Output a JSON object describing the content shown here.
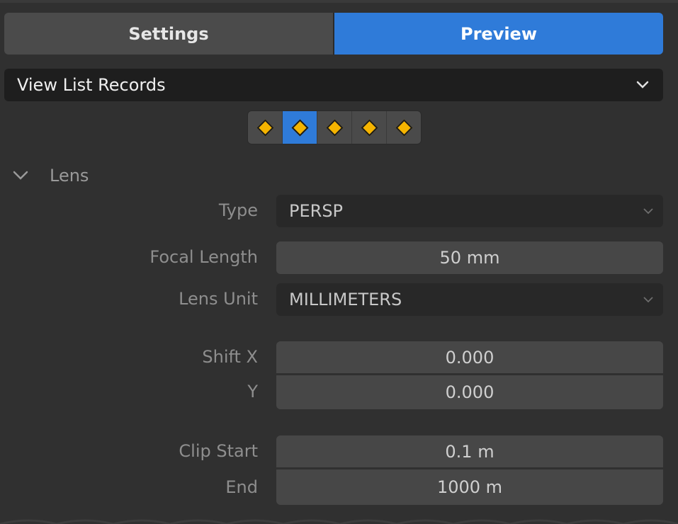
{
  "tabs": [
    {
      "label": "Settings",
      "active": false
    },
    {
      "label": "Preview",
      "active": true
    }
  ],
  "view_selector": {
    "label": "View List Records",
    "icon": "chevron-down-icon"
  },
  "keyframe_buttons": {
    "count": 5,
    "active_index": 1,
    "icon": "keyframe-diamond-icon",
    "colors": {
      "diamond": "#f5b400",
      "active_bg": "#2f7bd9"
    }
  },
  "panel": {
    "title": "Lens",
    "expanded": true,
    "type": {
      "label": "Type",
      "value": "PERSP"
    },
    "focal_length": {
      "label": "Focal Length",
      "value": "50 mm"
    },
    "lens_unit": {
      "label": "Lens Unit",
      "value": "MILLIMETERS"
    },
    "shift_x": {
      "label": "Shift X",
      "value": "0.000"
    },
    "shift_y": {
      "label": "Y",
      "value": "0.000"
    },
    "clip_start": {
      "label": "Clip Start",
      "value": "0.1 m"
    },
    "clip_end": {
      "label": "End",
      "value": "1000 m"
    }
  },
  "colors": {
    "accent": "#2f7bd9",
    "background": "#303030"
  }
}
